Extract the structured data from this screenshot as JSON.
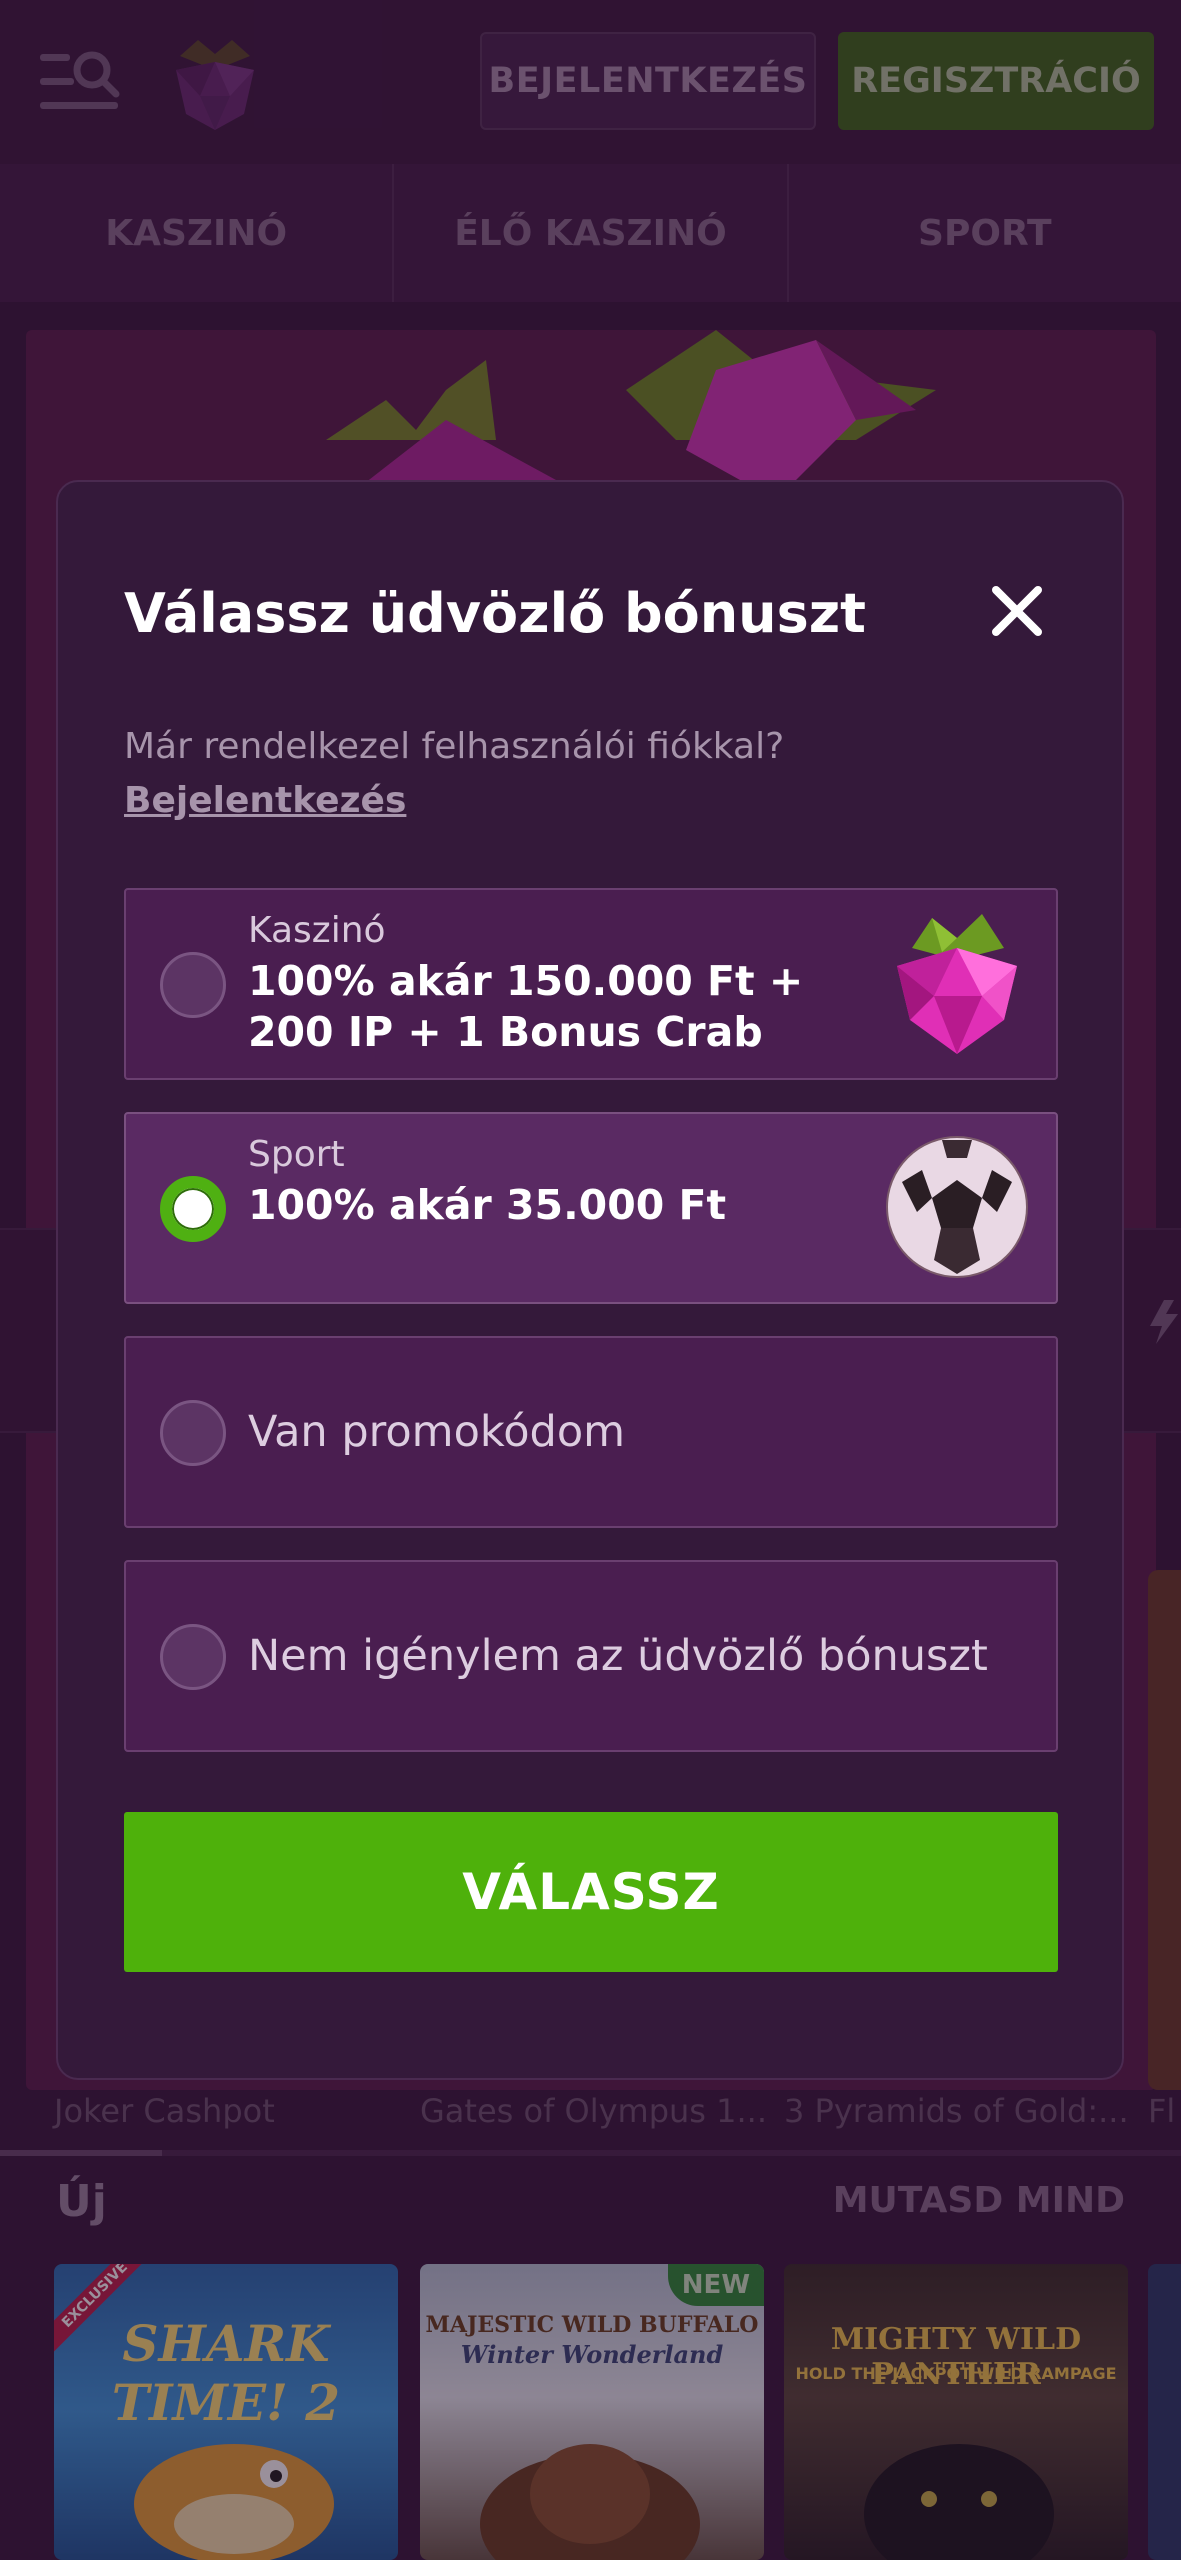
{
  "header": {
    "login_label": "BEJELENTKEZÉS",
    "register_label": "REGISZTRÁCIÓ"
  },
  "tabs": [
    {
      "label": "KASZINÓ"
    },
    {
      "label": "ÉLŐ KASZINÓ"
    },
    {
      "label": "SPORT"
    }
  ],
  "games_row": [
    "Joker Cashpot",
    "Gates of Olympus 1...",
    "3 Pyramids of Gold:...",
    "Fl"
  ],
  "new_section": {
    "title": "Új",
    "show_all": "MUTASD MIND",
    "games": [
      {
        "art_title": "SHARK TIME! 2",
        "badge": "EXCLUSIVE"
      },
      {
        "art_title": "MAJESTIC WILD BUFFALO",
        "art_sub": "Winter Wonderland",
        "badge": "NEW"
      },
      {
        "art_title": "MIGHTY WILD PANTHER",
        "art_sub": "HOLD THE JACKPOT WILD RAMPAGE"
      }
    ]
  },
  "modal": {
    "title": "Válassz üdvözlő bónuszt",
    "login_prompt": "Már rendelkezel felhasználói fiókkal?",
    "login_link": "Bejelentkezés",
    "options": [
      {
        "category": "Kaszinó",
        "description": "100% akár 150.000 Ft + 200 IP + 1 Bonus Crab",
        "icon": "raspberry-gem-icon",
        "selected": false
      },
      {
        "category": "Sport",
        "description": "100% akár 35.000 Ft",
        "icon": "soccer-ball-icon",
        "selected": true
      },
      {
        "label": "Van promokódom",
        "selected": false
      },
      {
        "label": "Nem igénylem az üdvözlő bónuszt",
        "selected": false
      }
    ],
    "submit_label": "VÁLASSZ"
  },
  "colors": {
    "accent_green": "#4eb10b",
    "modal_bg": "#34193a",
    "option_bg": "#4a1e50"
  }
}
